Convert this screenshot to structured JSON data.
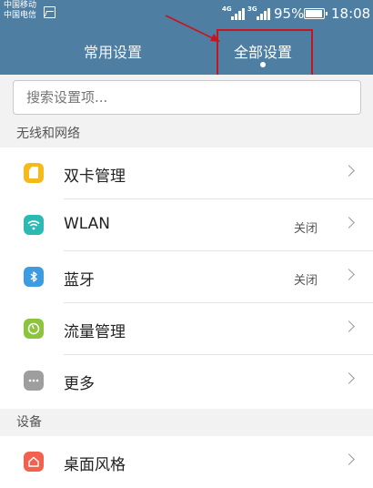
{
  "status_bar": {
    "carrier_1": "中国移动",
    "carrier_2": "中国电信",
    "signal_1_network": "4G",
    "signal_2_network": "3G",
    "battery_percent": "95%",
    "time": "18:08"
  },
  "tabs": [
    {
      "label": "常用设置",
      "selected": false
    },
    {
      "label": "全部设置",
      "selected": true
    }
  ],
  "search": {
    "placeholder": "搜索设置项..."
  },
  "sections": {
    "wireless": {
      "title": "无线和网络",
      "items": [
        {
          "label": "双卡管理",
          "value": "",
          "icon": "sim-card-icon"
        },
        {
          "label": "WLAN",
          "value": "关闭",
          "icon": "wifi-icon"
        },
        {
          "label": "蓝牙",
          "value": "关闭",
          "icon": "bluetooth-icon"
        },
        {
          "label": "流量管理",
          "value": "",
          "icon": "data-usage-icon"
        },
        {
          "label": "更多",
          "value": "",
          "icon": "more-icon"
        }
      ]
    },
    "device": {
      "title": "设备",
      "items": [
        {
          "label": "桌面风格",
          "value": "",
          "icon": "home-icon"
        }
      ]
    }
  },
  "colors": {
    "header": "#4e7fa3",
    "annotation": "#c8141f",
    "sim": "#f6b91c",
    "wlan": "#2db9b3",
    "bluetooth": "#3d9be0",
    "data": "#8cc43e",
    "more": "#9e9e9e",
    "home": "#f2614d"
  }
}
